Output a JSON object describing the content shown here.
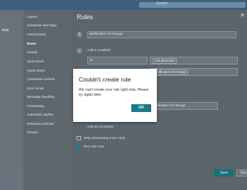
{
  "topbar": {
    "search_text": "Search"
  },
  "left_nav": {
    "label": "Mail"
  },
  "settings_menu": [
    "Layout",
    "Compose and reply",
    "Attachments",
    "Rules",
    "Sweep",
    "Junk email",
    "Quick steps",
    "Customize actions",
    "Sync email",
    "Message handling",
    "Forwarding",
    "Automatic replies",
    "Retention policies",
    "Groups"
  ],
  "settings_active": "Rules",
  "panel": {
    "title": "Rules",
    "rule_name": "Notification of Change",
    "add_condition": "Add a condition",
    "condition_field": "To",
    "recipient_pill": "CSL@domain",
    "subject_pill": "Notification of Change",
    "action_value": "Notification of Change",
    "add_action": "Add an exception",
    "stop_processing": "Stop processing more rules",
    "run_now": "Run rule now",
    "save": "Save",
    "discard": "Disc"
  },
  "bottom_email": {
    "line1": "CSL@domain",
    "line2": "Notification of Change"
  },
  "dialog": {
    "title": "Couldn't create rule",
    "message": "We can't create your rule right now. Please try again later.",
    "ok": "OK"
  },
  "colors": {
    "accent": "#197a86",
    "overlay": "#55606b"
  }
}
